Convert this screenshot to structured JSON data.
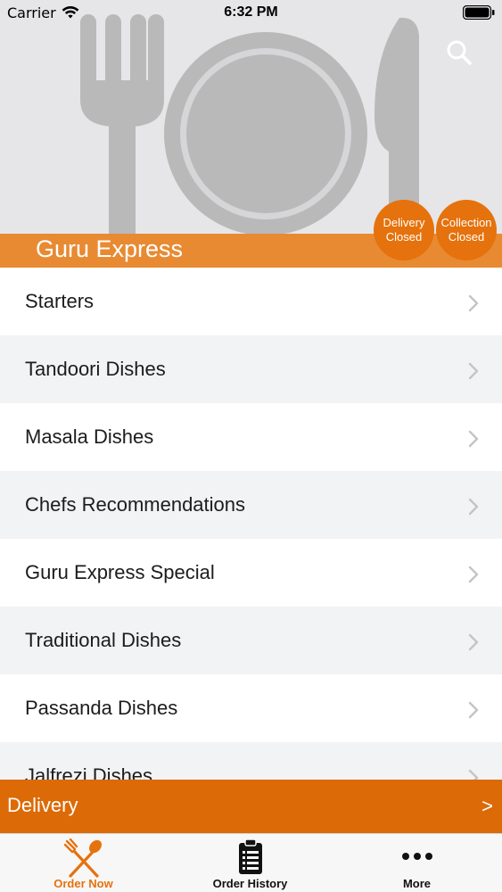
{
  "status_bar": {
    "carrier": "Carrier",
    "time": "6:32 PM",
    "icons": [
      "wifi-icon",
      "battery-icon"
    ]
  },
  "header": {
    "restaurant_name": "Guru Express",
    "search_icon": "search-icon",
    "badges": [
      {
        "line1": "Delivery",
        "line2": "Closed"
      },
      {
        "line1": "Collection",
        "line2": "Closed"
      }
    ]
  },
  "menu": {
    "categories": [
      "Starters",
      "Tandoori Dishes",
      "Masala Dishes",
      "Chefs Recommendations",
      "Guru Express Special",
      "Traditional Dishes",
      "Passanda Dishes",
      "Jalfrezi Dishes"
    ]
  },
  "delivery_bar": {
    "label": "Delivery",
    "arrow": ">"
  },
  "tab_bar": {
    "tabs": [
      {
        "label": "Order Now",
        "icon": "fork-spoon-icon",
        "active": true
      },
      {
        "label": "Order History",
        "icon": "clipboard-list-icon",
        "active": false
      },
      {
        "label": "More",
        "icon": "more-dots-icon",
        "active": false
      }
    ]
  },
  "colors": {
    "accent": "#e5720d",
    "header_strip": "#e88a32",
    "delivery_bar": "#dc6a06",
    "active_tab": "#e5720d",
    "inactive_tab": "#111111",
    "hero_bg": "#e6e6e8",
    "hero_art": "#b9b9ba"
  }
}
